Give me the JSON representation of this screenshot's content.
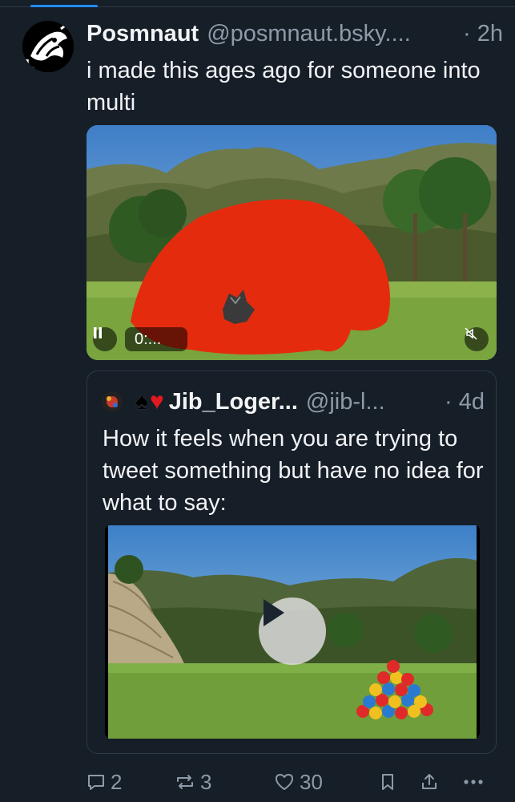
{
  "post": {
    "author_name": "Posmnaut",
    "author_handle": "@posmnaut.bsky....",
    "time": "· 2h",
    "text": "i made this ages ago for someone into multi",
    "video": {
      "time_label": "0:..."
    }
  },
  "quote": {
    "author_name": "Jib_Loger...",
    "author_handle": "@jib-l...",
    "time": "· 4d",
    "text": "How it feels when you are trying to tweet something but have no idea for what to say:"
  },
  "actions": {
    "reply_count": "2",
    "repost_count": "3",
    "like_count": "30"
  },
  "colors": {
    "background": "#161e27",
    "accent": "#208bfe",
    "muted_text": "#8d9aa8",
    "scribble_red": "#e52b0d"
  },
  "icons": [
    "avatar",
    "pause-icon",
    "mute-icon",
    "spade-icon",
    "heart-icon",
    "play-icon",
    "reply-icon",
    "repost-icon",
    "like-icon",
    "bookmark-icon",
    "share-icon",
    "more-icon"
  ]
}
